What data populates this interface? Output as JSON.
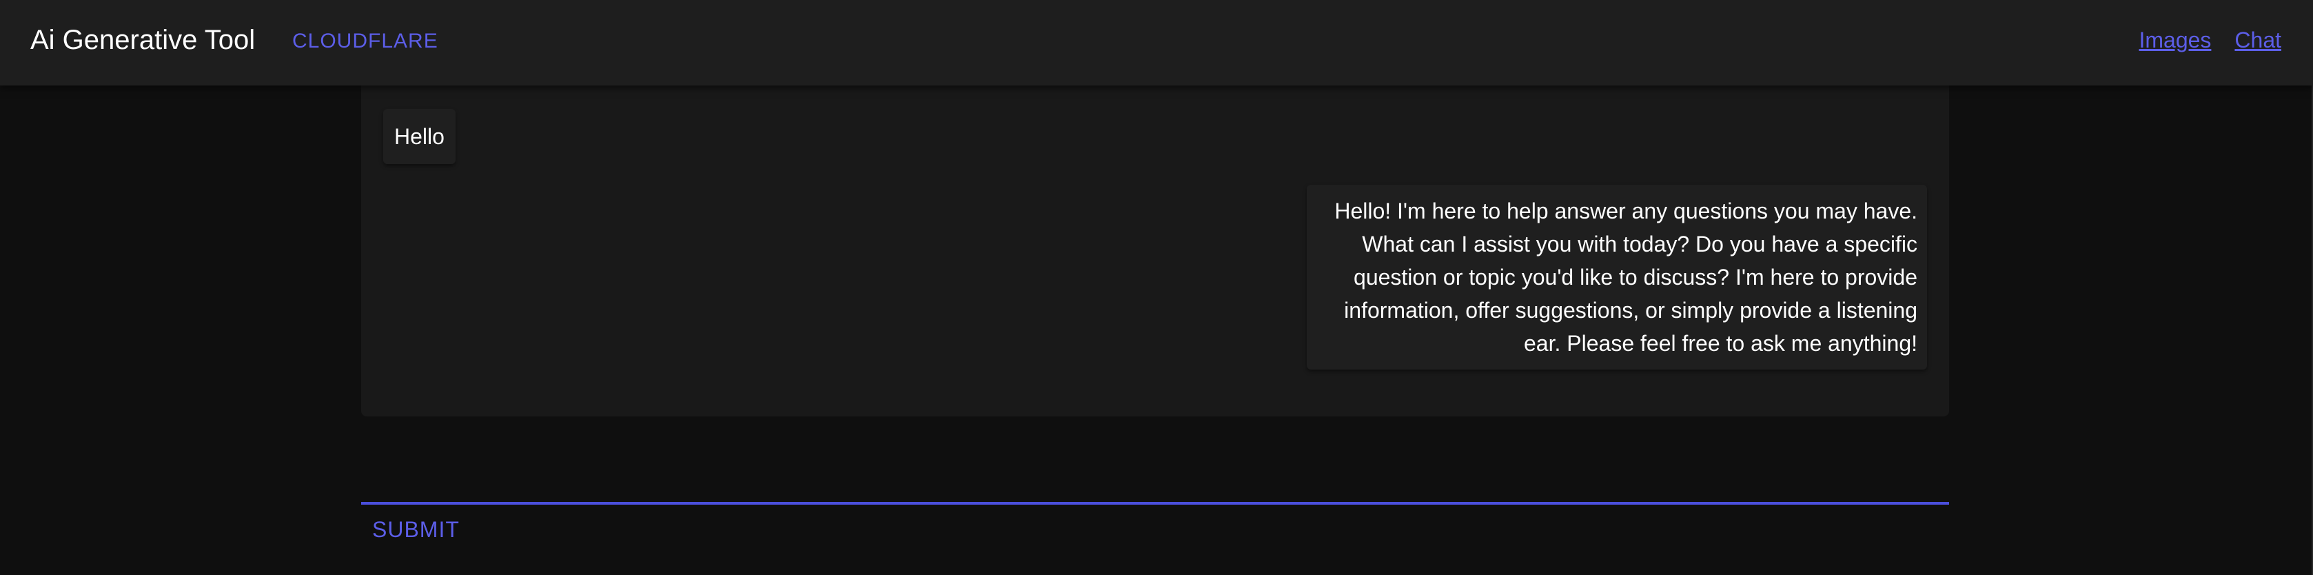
{
  "header": {
    "title": "Ai Generative Tool",
    "provider": "CLOUDFLARE",
    "nav": [
      {
        "label": "Images"
      },
      {
        "label": "Chat"
      }
    ]
  },
  "chat": {
    "messages": [
      {
        "role": "user",
        "text": "Hello"
      },
      {
        "role": "assistant",
        "text": "Hello! I'm here to help answer any questions you may have. What can I assist you with today? Do you have a specific question or topic you'd like to discuss? I'm here to provide information, offer suggestions, or simply provide a listening ear. Please feel free to ask me anything!"
      }
    ]
  },
  "composer": {
    "submit_label": "SUBMIT"
  },
  "colors": {
    "accent": "#5c5ee8",
    "header_bg": "#1e1e1e",
    "page_bg": "#0f0f0f",
    "panel_bg": "#191919",
    "bubble_bg": "#1f1f1f"
  }
}
